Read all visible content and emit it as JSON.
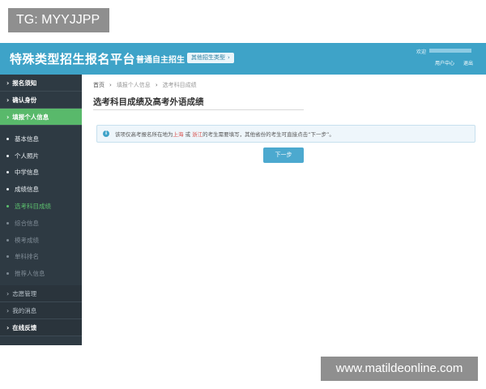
{
  "corner_tag": "TG: MYYJJPP",
  "watermark": "www.matildeonline.com",
  "header": {
    "title": "特殊类型招生报名平台",
    "subtitle": "普通自主招生",
    "other_types_button": "其他招生类型",
    "welcome": "欢迎",
    "user_center": "用户中心",
    "logout": "退出"
  },
  "sidebar": {
    "top_items": [
      {
        "label": "报名须知"
      },
      {
        "label": "确认身份"
      },
      {
        "label": "填报个人信息"
      }
    ],
    "sub_items": [
      {
        "label": "基本信息"
      },
      {
        "label": "个人照片"
      },
      {
        "label": "中学信息"
      },
      {
        "label": "成绩信息"
      },
      {
        "label": "选考科目成绩"
      },
      {
        "label": "综合信息"
      },
      {
        "label": "模考成绩"
      },
      {
        "label": "单科排名"
      },
      {
        "label": "推荐人信息"
      }
    ],
    "bottom_items": [
      {
        "label": "志愿管理"
      },
      {
        "label": "我的消息"
      },
      {
        "label": "在线反馈"
      }
    ]
  },
  "main": {
    "breadcrumb": [
      "首页",
      "填报个人信息",
      "选考科目成绩"
    ],
    "title": "选考科目成绩及高考外语成绩",
    "notice_pre": "该项仅高考报名所在地为",
    "notice_shanghai": "上海",
    "notice_or": "或",
    "notice_zhejiang": "浙江",
    "notice_post": "的考生需要填写，其他省份的考生可直接点击“下一步”。",
    "next_button": "下一步"
  },
  "colors": {
    "header_bg": "#3ea3c8",
    "sidebar_bg": "#2e3a43",
    "active_green": "#59b96b"
  }
}
